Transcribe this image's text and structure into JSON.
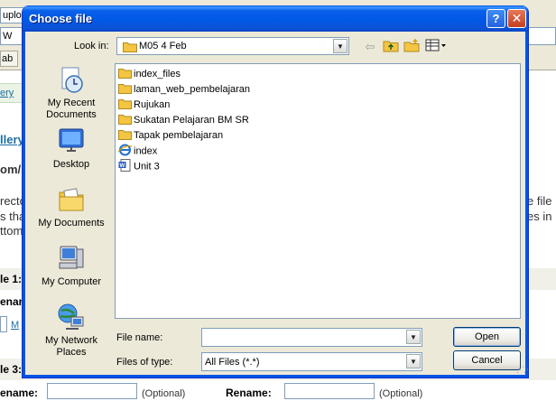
{
  "background_page": {
    "url_fragment": "uploa",
    "address_fragment": "W",
    "tab_fragment": "ab",
    "link_gallery_fragment": "ery",
    "link_gallery2_fragment": "llery'",
    "text_om": "om/",
    "text_directo": "recto",
    "text_is_tha": "s tha",
    "text_ottom": "ttom",
    "text_e_file": "e file",
    "text_es_in": "es in",
    "label_file1": "le 1:",
    "label_renam": "enan",
    "label_m": "M",
    "label_file3": "le 3:",
    "rename_label_left": "ename:",
    "rename_label_right": "Rename:",
    "optional_left": "(Optional)",
    "optional_right": "(Optional)"
  },
  "dialog": {
    "title": "Choose file",
    "help_symbol": "?",
    "close_symbol": "✕",
    "look_in_label": "Look in:",
    "look_in_value": "M05 4 Feb",
    "places": [
      {
        "label": "My Recent Documents",
        "icon": "recent-documents-icon"
      },
      {
        "label": "Desktop",
        "icon": "desktop-icon"
      },
      {
        "label": "My Documents",
        "icon": "my-documents-icon"
      },
      {
        "label": "My Computer",
        "icon": "my-computer-icon"
      },
      {
        "label": "My Network Places",
        "icon": "network-places-icon"
      }
    ],
    "files": [
      {
        "name": "index_files",
        "type": "folder"
      },
      {
        "name": "laman_web_pembelajaran",
        "type": "folder"
      },
      {
        "name": "Rujukan",
        "type": "folder"
      },
      {
        "name": "Sukatan Pelajaran BM SR",
        "type": "folder"
      },
      {
        "name": "Tapak pembelajaran",
        "type": "folder"
      },
      {
        "name": "index",
        "type": "html"
      },
      {
        "name": "Unit 3",
        "type": "word"
      }
    ],
    "file_name_label": "File name:",
    "file_name_value": "",
    "files_of_type_label": "Files of type:",
    "files_of_type_value": "All Files (*.*)",
    "open_label": "Open",
    "cancel_label": "Cancel"
  },
  "colors": {
    "titlebar": "#0058e6",
    "dialog_face": "#ece9d8",
    "folder": "#f4c542",
    "link": "#1c6ea8"
  }
}
